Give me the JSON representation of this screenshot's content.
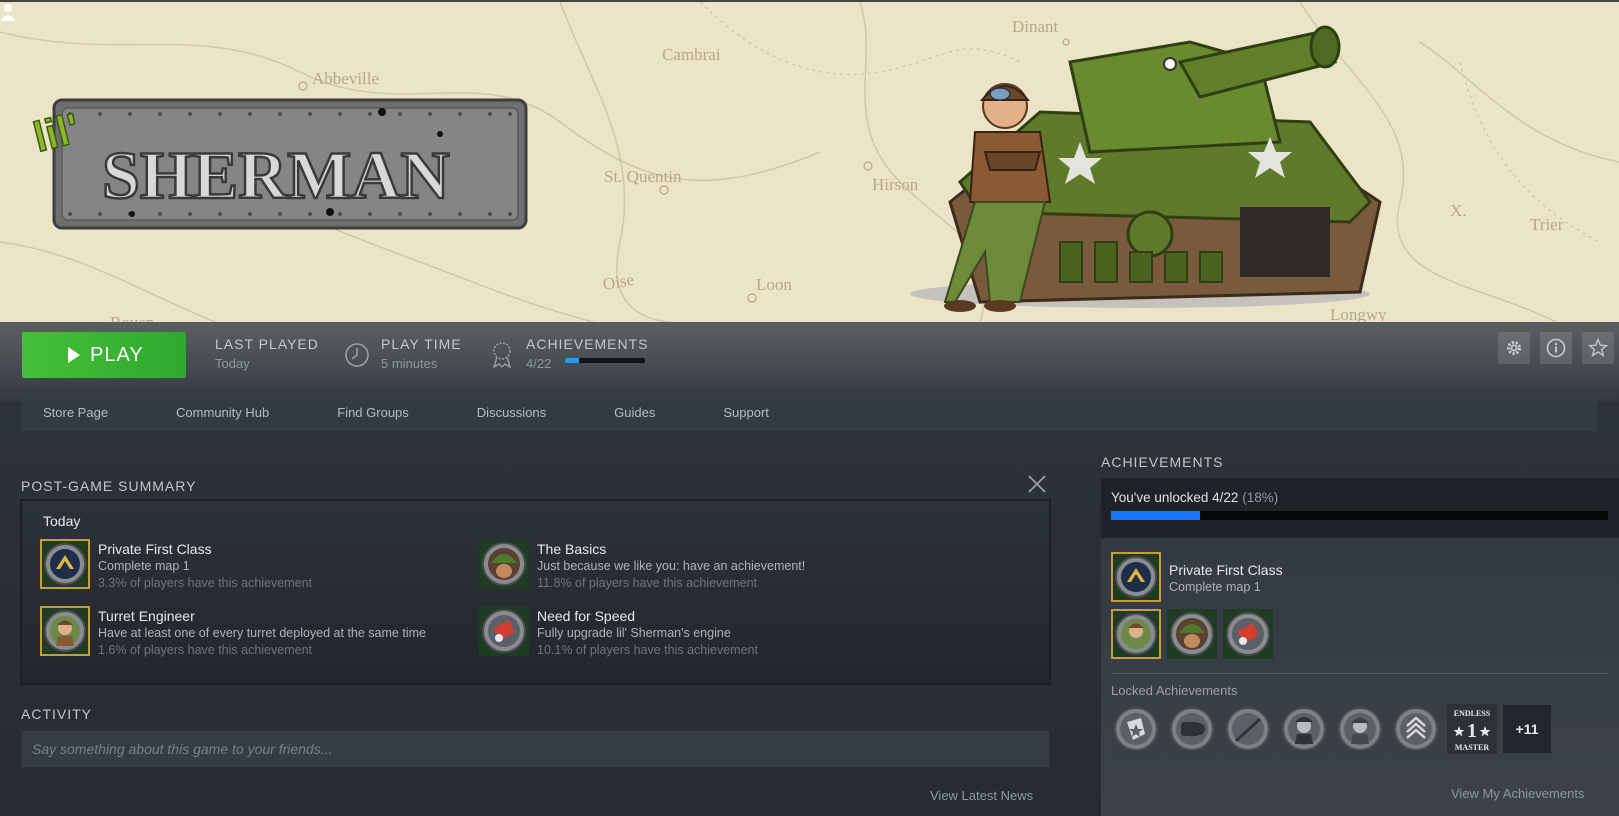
{
  "hero": {
    "logo_text": "SHERMAN",
    "logo_prefix": "lil'",
    "map_labels": [
      "Dinant",
      "Cambrai",
      "Abbeville",
      "St. Quentin",
      "Hirson",
      "Loon",
      "Oise",
      "Trier",
      "Rouen",
      "Longwy"
    ]
  },
  "gamebar": {
    "play_label": "PLAY",
    "last_played_title": "LAST PLAYED",
    "last_played_value": "Today",
    "play_time_title": "PLAY TIME",
    "play_time_value": "5 minutes",
    "achievements_title": "ACHIEVEMENTS",
    "achievements_value": "4/22",
    "achievements_progress": 0.18
  },
  "nav": {
    "items": [
      "Store Page",
      "Community Hub",
      "Find Groups",
      "Discussions",
      "Guides",
      "Support"
    ]
  },
  "summary": {
    "title": "POST-GAME SUMMARY",
    "today": "Today",
    "achievements": [
      {
        "name": "Private First Class",
        "desc": "Complete map 1",
        "pct": "3.3% of players have this achievement",
        "icon": "chevron-rank-icon"
      },
      {
        "name": "The Basics",
        "desc": "Just because we like you: have an achievement!",
        "pct": "11.8% of players have this achievement",
        "icon": "soldier-helmet-icon"
      },
      {
        "name": "Turret Engineer",
        "desc": "Have at least one of every turret deployed at the same time",
        "pct": "1.6% of players have this achievement",
        "icon": "engineer-icon"
      },
      {
        "name": "Need for Speed",
        "desc": "Fully upgrade lil' Sherman's engine",
        "pct": "10.1% of players have this achievement",
        "icon": "engine-icon"
      }
    ]
  },
  "activity": {
    "title": "ACTIVITY",
    "placeholder": "Say something about this game to your friends...",
    "view_news": "View Latest News"
  },
  "achievements_panel": {
    "title": "ACHIEVEMENTS",
    "unlocked_text": "You've unlocked 4/22",
    "unlocked_pct": "(18%)",
    "progress": 0.18,
    "featured_name": "Private First Class",
    "featured_desc": "Complete map 1",
    "locked_title": "Locked Achievements",
    "more_count": "+11",
    "view_all": "View My Achievements"
  },
  "colors": {
    "play_green": "#47bf3a",
    "progress_blue": "#1a9fff",
    "badge_gold": "#c79d3a"
  }
}
